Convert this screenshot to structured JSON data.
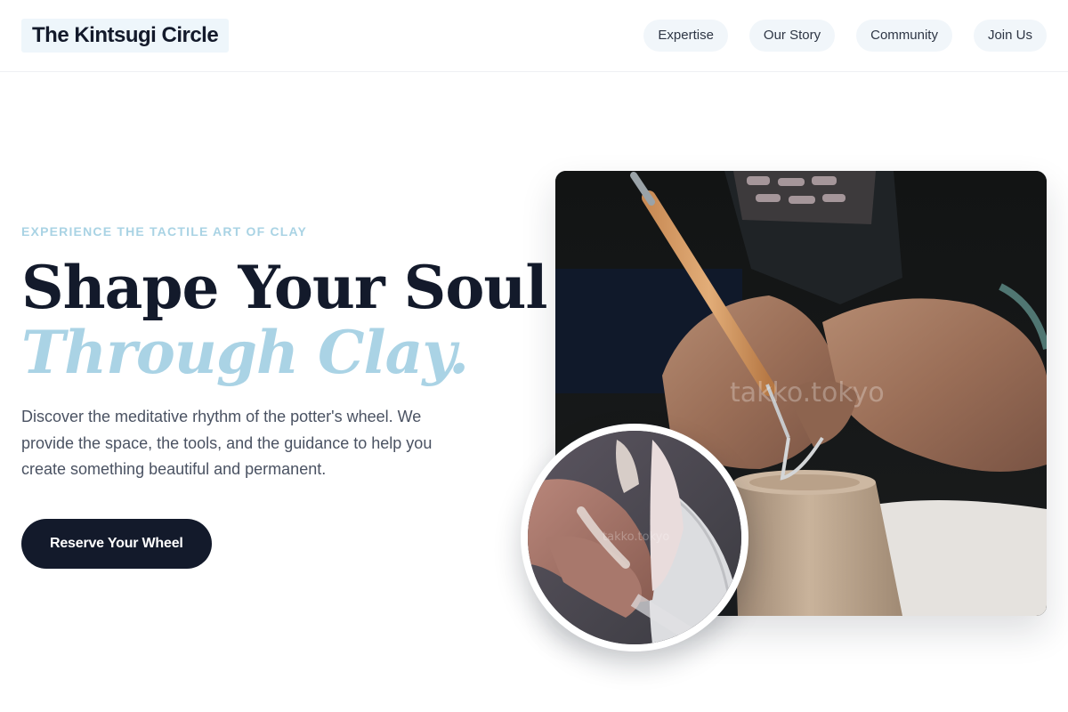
{
  "header": {
    "logo": "The Kintsugi Circle",
    "nav": [
      {
        "label": "Expertise"
      },
      {
        "label": "Our Story"
      },
      {
        "label": "Community"
      },
      {
        "label": "Join Us"
      }
    ]
  },
  "hero": {
    "eyebrow": "EXPERIENCE THE TACTILE ART OF CLAY",
    "headline_line1": "Shape Your Soul",
    "headline_line2": "Through Clay.",
    "body": "Discover the meditative rhythm of the potter's wheel. We provide the space, the tools, and the guidance to help you create something beautiful and permanent.",
    "cta_label": "Reserve Your Wheel"
  },
  "photos": {
    "main_watermark": "takko.tokyo",
    "inset_watermark": "takko.tokyo"
  },
  "colors": {
    "navy": "#131a2b",
    "accent_blue": "#aad3e5",
    "nav_pill_bg": "#f1f6fa",
    "logo_bg": "#eef6fb"
  }
}
